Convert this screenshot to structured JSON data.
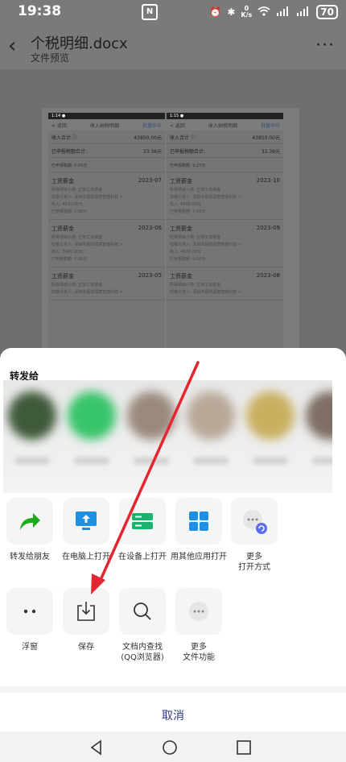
{
  "status_bar": {
    "time": "19:38",
    "nfc": "N",
    "speed_top": "0",
    "speed_unit": "K/s",
    "battery": "70",
    "icons": [
      "alarm-icon",
      "bluetooth-icon",
      "wifi-icon",
      "signal-icon",
      "signal-icon"
    ]
  },
  "header": {
    "title": "个税明细.docx",
    "subtitle": "文件预览",
    "back_icon": "chevron-left-icon",
    "more_icon": "more-icon"
  },
  "doc_preview": {
    "shots": [
      {
        "time": "1:14 ●",
        "back": "< 返回",
        "title": "收入纳税明细",
        "action": "批量申诉",
        "income_label": "收入合计 ⓘ",
        "income_value": "43850.00元",
        "tax_label": "已申报税额合计:",
        "tax_value": "33.38元",
        "partial": "已申报税额: 0.00元",
        "entries": [
          {
            "name": "工资薪金",
            "period": "2023-07",
            "l1": "所得项目小类: 正常工资薪金",
            "l2": "扣缴义务人: 深圳市嘉祥润宸智能科技 >",
            "l3": "收入: 4630.00元",
            "l4": "已申报税额: 0.00元"
          },
          {
            "name": "工资薪金",
            "period": "2023-06",
            "l1": "所得项目小类: 正常工资薪金",
            "l2": "扣缴义务人: 深圳市嘉祥润宸智能科技 >",
            "l3": "收入: 3600.00元",
            "l4": "已申报税额: 0.00元"
          },
          {
            "name": "工资薪金",
            "period": "2023-05",
            "l1": "所得项目小类: 正常工资薪金",
            "l2": "扣缴义务人: 深圳市嘉祥润宸智能科技 >",
            "l3": "",
            "l4": ""
          }
        ]
      },
      {
        "time": "1:15 ●",
        "back": "< 返回",
        "title": "收入纳税明细",
        "action": "批量申诉",
        "income_label": "收入合计 ⓘ",
        "income_value": "43850.00元",
        "tax_label": "已申报税额合计:",
        "tax_value": "33.38元",
        "partial": "已申报税额: 9.27元",
        "entries": [
          {
            "name": "工资薪金",
            "period": "2023-10",
            "l1": "所得项目小类: 正常工资薪金",
            "l2": "扣缴义务人: 深圳市嘉祥润宸智能科技 >",
            "l3": "收入: 6900.00元",
            "l4": "已申报税额: 7.42元"
          },
          {
            "name": "工资薪金",
            "period": "2023-09",
            "l1": "所得项目小类: 正常工资薪金",
            "l2": "扣缴义务人: 深圳市嘉祥润宸智能科技 >",
            "l3": "收入: 4630.00元",
            "l4": "已申报税额: 0.00元"
          },
          {
            "name": "工资薪金",
            "period": "2023-08",
            "l1": "所得项目小类: 正常工资薪金",
            "l2": "扣缴义务人: 深圳市嘉祥润宸智能科技 >",
            "l3": "",
            "l4": ""
          }
        ]
      }
    ]
  },
  "share_sheet": {
    "title": "转发给",
    "contact_colors": [
      "#3f5a3a",
      "#38c46a",
      "#9a8a7c",
      "#b8a898",
      "#c8b060",
      "#7e6e64"
    ],
    "row1": [
      {
        "label": "转发给朋友",
        "icon": "share-arrow-icon"
      },
      {
        "label": "在电脑上打开",
        "icon": "monitor-upload-icon"
      },
      {
        "label": "在设备上打开",
        "icon": "device-icon"
      },
      {
        "label": "用其他应用打开",
        "icon": "apps-grid-icon"
      },
      {
        "label": "更多\n打开方式",
        "icon": "more-open-icon"
      }
    ],
    "row2": [
      {
        "label": "浮窗",
        "icon": "float-window-icon"
      },
      {
        "label": "保存",
        "icon": "save-download-icon"
      },
      {
        "label": "文档内查找\n(QQ浏览器)",
        "icon": "search-icon"
      },
      {
        "label": "更多\n文件功能",
        "icon": "more-file-icon"
      }
    ],
    "cancel": "取消"
  },
  "colors": {
    "accent_green": "#1aad19",
    "accent_blue": "#1e8fe1",
    "arrow_red": "#e3262f",
    "cancel_text": "#2b3b8a"
  }
}
